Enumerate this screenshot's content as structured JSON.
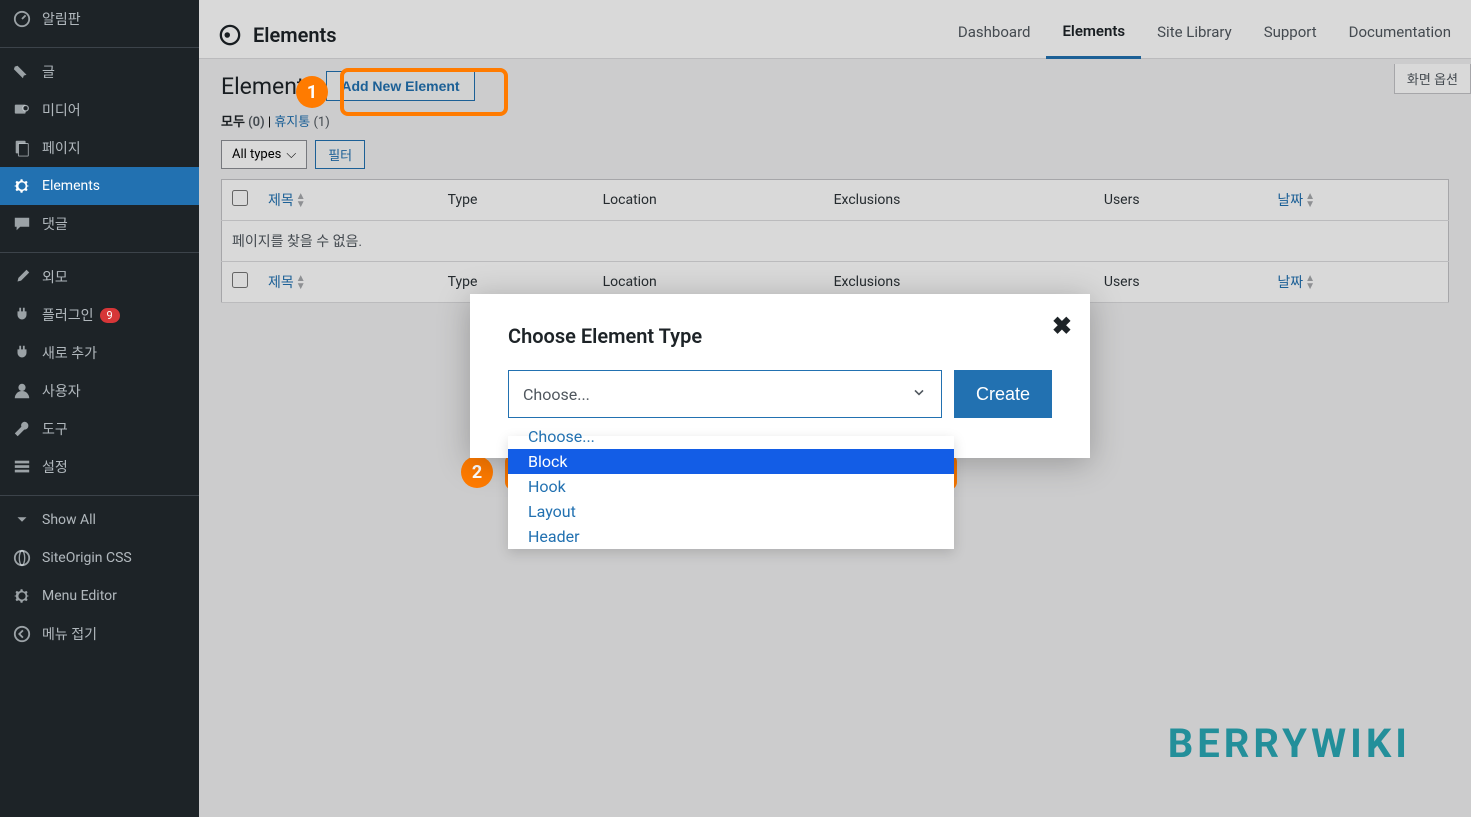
{
  "sidebar": {
    "items": [
      {
        "label": "알림판",
        "icon": "dashboard"
      },
      {
        "label": "글",
        "icon": "pin"
      },
      {
        "label": "미디어",
        "icon": "media"
      },
      {
        "label": "페이지",
        "icon": "page"
      },
      {
        "label": "Elements",
        "icon": "gear",
        "active": true
      },
      {
        "label": "댓글",
        "icon": "comment"
      },
      {
        "label": "외모",
        "icon": "brush"
      },
      {
        "label": "플러그인",
        "icon": "plugin",
        "badge": "9"
      },
      {
        "label": "새로 추가",
        "icon": "plugin"
      },
      {
        "label": "사용자",
        "icon": "user"
      },
      {
        "label": "도구",
        "icon": "wrench"
      },
      {
        "label": "설정",
        "icon": "settings"
      },
      {
        "label": "Show All",
        "icon": "chevron"
      },
      {
        "label": "SiteOrigin CSS",
        "icon": "globe"
      },
      {
        "label": "Menu Editor",
        "icon": "gear"
      },
      {
        "label": "메뉴 접기",
        "icon": "collapse"
      }
    ]
  },
  "header": {
    "brand": "Elements",
    "tabs": [
      {
        "label": "Dashboard"
      },
      {
        "label": "Elements",
        "active": true
      },
      {
        "label": "Site Library"
      },
      {
        "label": "Support"
      },
      {
        "label": "Documentation"
      }
    ]
  },
  "page": {
    "heading": "Elements",
    "add_new_label": "Add New Element",
    "screen_options": "화면 옵션"
  },
  "subsub": {
    "all_label": "모두",
    "all_count": "(0)",
    "trash_label": "휴지통",
    "trash_count": "(1)"
  },
  "filters": {
    "all_types_label": "All types",
    "filter_btn": "필터"
  },
  "table": {
    "cols": {
      "title": "제목",
      "type": "Type",
      "location": "Location",
      "exclusions": "Exclusions",
      "users": "Users",
      "date": "날짜"
    },
    "no_items": "페이지를 찾을 수 없음."
  },
  "modal": {
    "title": "Choose Element Type",
    "placeholder": "Choose...",
    "create_btn": "Create",
    "options": [
      {
        "label": "Choose..."
      },
      {
        "label": "Block",
        "highlighted": true
      },
      {
        "label": "Hook"
      },
      {
        "label": "Layout"
      },
      {
        "label": "Header"
      }
    ]
  },
  "callouts": {
    "one": "1",
    "two": "2"
  },
  "watermark": "BERRYWIKI"
}
